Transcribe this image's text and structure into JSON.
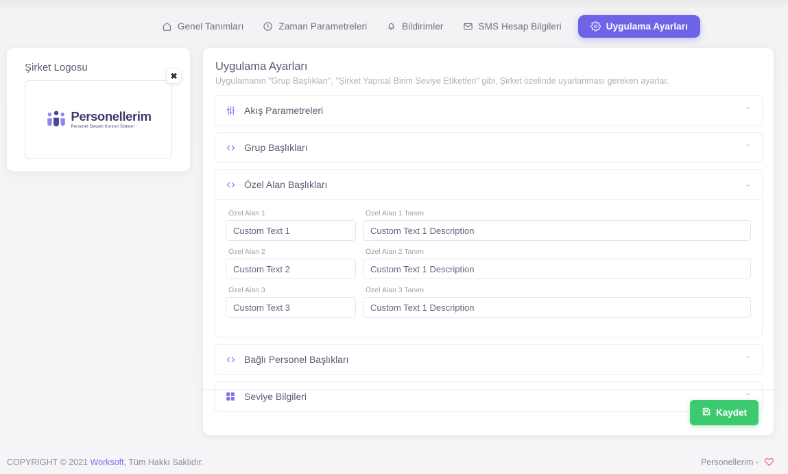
{
  "nav": {
    "tabs": [
      {
        "label": "Genel Tanımları",
        "icon": "home-icon",
        "active": false
      },
      {
        "label": "Zaman Parametreleri",
        "icon": "clock-icon",
        "active": false
      },
      {
        "label": "Bildirimler",
        "icon": "bell-icon",
        "active": false
      },
      {
        "label": "SMS Hesap Bilgileri",
        "icon": "envelope-icon",
        "active": false
      },
      {
        "label": "Uygulama Ayarları",
        "icon": "gear-icon",
        "active": true
      }
    ]
  },
  "logo_card": {
    "title": "Şirket Logosu",
    "close_label": "✖",
    "brand_name": "Personellerim",
    "brand_tagline": "Personel Devam Kontrol Sistemi"
  },
  "main": {
    "title": "Uygulama Ayarları",
    "subtitle": "Uygulamanın \"Grup Başlıkları\", \"Şirket Yapısal Birim Seviye Etiketleri\" gibi, Şirket özelinde uyarlanması gereken ayarlar.",
    "sections": [
      {
        "title": "Akış Parametreleri",
        "icon": "sliders-icon",
        "expanded": false,
        "chevron": "⌃"
      },
      {
        "title": "Grup Başlıkları",
        "icon": "code-icon",
        "expanded": false,
        "chevron": "⌃"
      },
      {
        "title": "Özel Alan Başlıkları",
        "icon": "code-icon",
        "expanded": true,
        "chevron": "⌄"
      },
      {
        "title": "Bağlı Personel Başlıkları",
        "icon": "code-icon",
        "expanded": false,
        "chevron": "⌃"
      },
      {
        "title": "Seviye Bilgileri",
        "icon": "grid-icon",
        "expanded": false,
        "chevron": "⌃"
      }
    ],
    "custom_fields": [
      {
        "name_label": "Özel Alan 1",
        "name_value": "Custom Text 1",
        "desc_label": "Özel Alan 1 Tanım",
        "desc_value": "Custom Text 1 Description"
      },
      {
        "name_label": "Özel Alan 2",
        "name_value": "Custom Text 2",
        "desc_label": "Özel Alan 2 Tanım",
        "desc_value": "Custom Text 1 Description"
      },
      {
        "name_label": "Özel Alan 3",
        "name_value": "Custom Text 3",
        "desc_label": "Özel Alan 3 Tanım",
        "desc_value": "Custom Text 1 Description"
      }
    ],
    "save_button": "Kaydet",
    "save_icon": "floppy-disk-icon"
  },
  "footer": {
    "copyright_prefix": "COPYRIGHT © 2021",
    "company_link": "Worksoft",
    "copyright_suffix": ", Tüm Hakkı Saklıdır.",
    "right_text": "Personellerim -",
    "heart_icon": "heart-icon"
  },
  "colors": {
    "accent_purple": "#6f64e8",
    "save_green": "#3dca6e",
    "heart_red": "#f1606a",
    "text_muted": "#9a9dad"
  }
}
